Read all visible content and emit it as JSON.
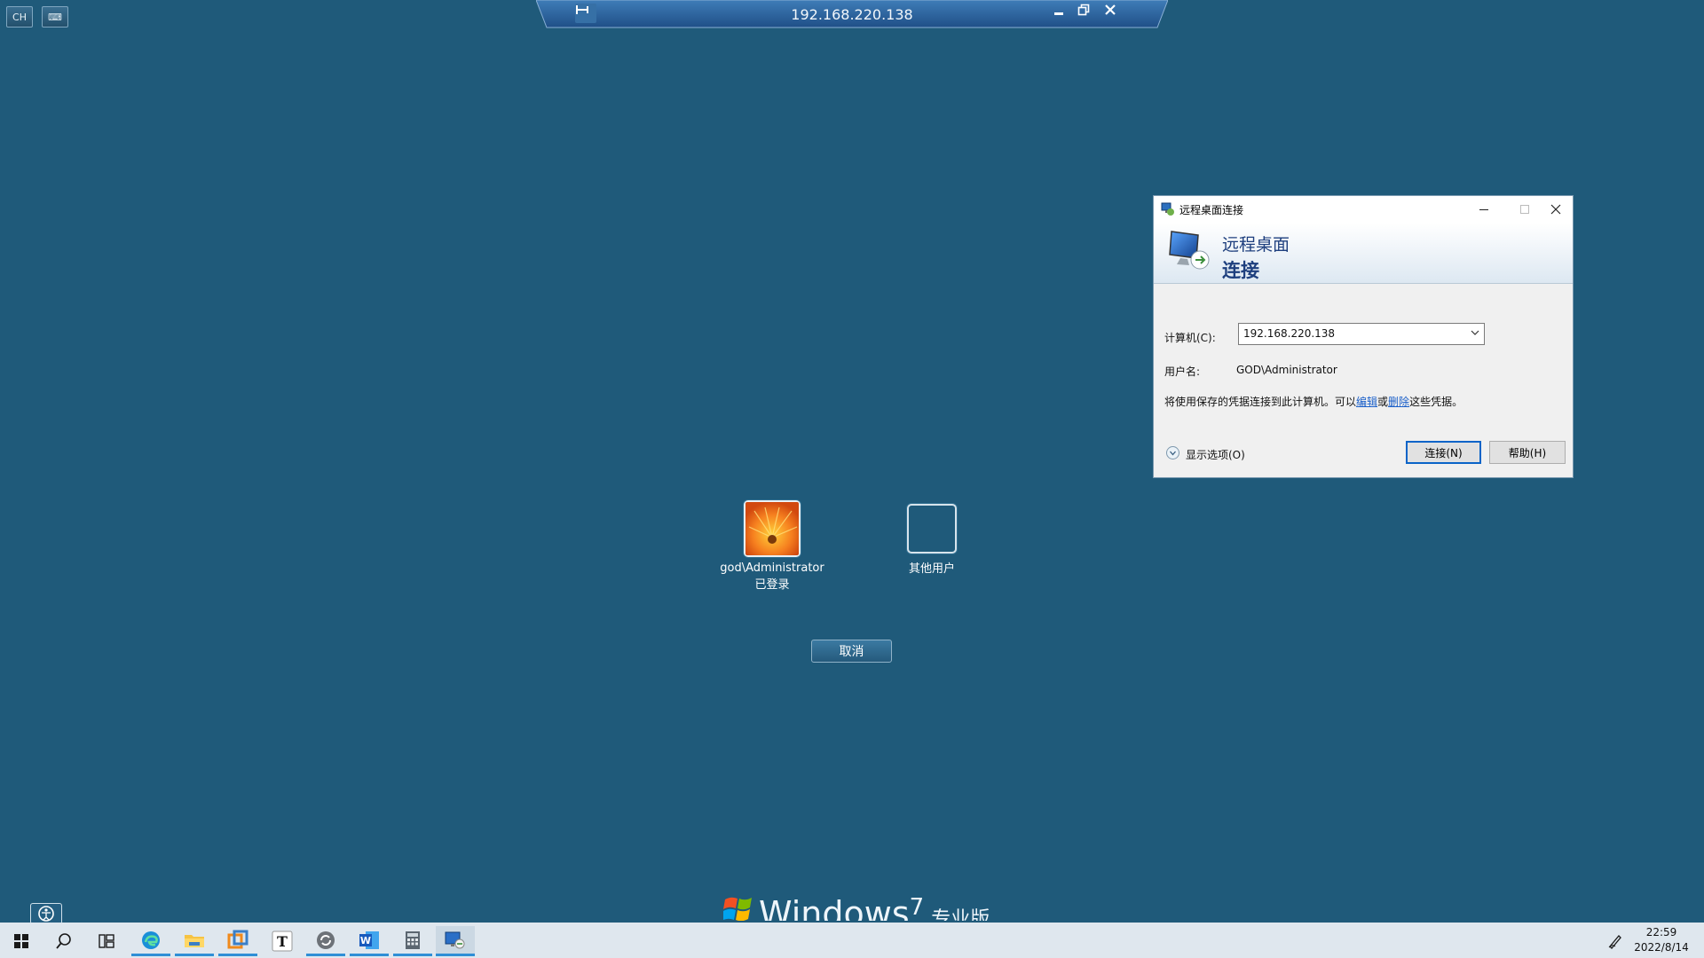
{
  "top_left": {
    "ime_label": "CH",
    "keyboard_label": "⌨"
  },
  "connection_bar": {
    "title": "192.168.220.138"
  },
  "login": {
    "users": [
      {
        "name": "god\\Administrator",
        "status": "已登录"
      },
      {
        "name": "其他用户",
        "status": ""
      }
    ],
    "cancel_label": "取消",
    "brand": "Windows",
    "brand_version": "7",
    "edition": "专业版"
  },
  "dialog": {
    "title": "远程桌面连接",
    "header_line1": "远程桌面",
    "header_line2": "连接",
    "computer_label": "计算机(C):",
    "computer_value": "192.168.220.138",
    "username_label": "用户名:",
    "username_value": "GOD\\Administrator",
    "cred_text_pre": "将使用保存的凭据连接到此计算机。可以",
    "cred_link_edit": "编辑",
    "cred_text_or": "或",
    "cred_link_delete": "删除",
    "cred_text_post": "这些凭据。",
    "show_options": "显示选项(O)",
    "connect_button": "连接(N)",
    "help_button": "帮助(H)"
  },
  "taskbar": {
    "apps": [
      "windows-start-icon",
      "search-icon",
      "task-view-icon",
      "edge-icon",
      "file-explorer-icon",
      "vmware-icon",
      "typora-icon",
      "sync-icon",
      "word-icon",
      "calculator-icon",
      "remote-desktop-icon"
    ],
    "time": "22:59",
    "date": "2022/8/14"
  },
  "colors": {
    "desktop_bg": "#1f5a7a",
    "accent": "#0a64c8",
    "header_text": "#1e3f7e"
  }
}
